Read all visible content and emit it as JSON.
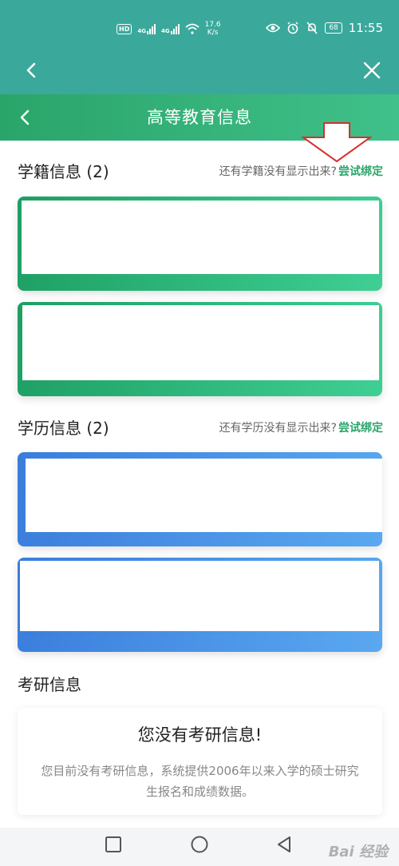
{
  "status_bar": {
    "hd": "HD",
    "signal1": "4G",
    "signal2": "4G",
    "speed_value": "17.6",
    "speed_unit": "K/s",
    "battery": "68",
    "time": "11:55"
  },
  "header": {
    "title": "高等教育信息"
  },
  "enrollment": {
    "title": "学籍信息 (2)",
    "hint": "还有学籍没有显示出来?",
    "link": "尝试绑定"
  },
  "degree": {
    "title": "学历信息 (2)",
    "hint": "还有学历没有显示出来?",
    "link": "尝试绑定"
  },
  "postgrad": {
    "title": "考研信息",
    "empty_title": "您没有考研信息!",
    "empty_desc": "您目前没有考研信息，系统提供2006年以来入学的硕士研究生报名和成绩数据。"
  },
  "watermark": "Bai 经验",
  "colors": {
    "browser_bar": "#3aa99c",
    "accent_green": "#2aa56a",
    "card_blue": "#3a7ddc",
    "annotation_red": "#d9302c"
  }
}
